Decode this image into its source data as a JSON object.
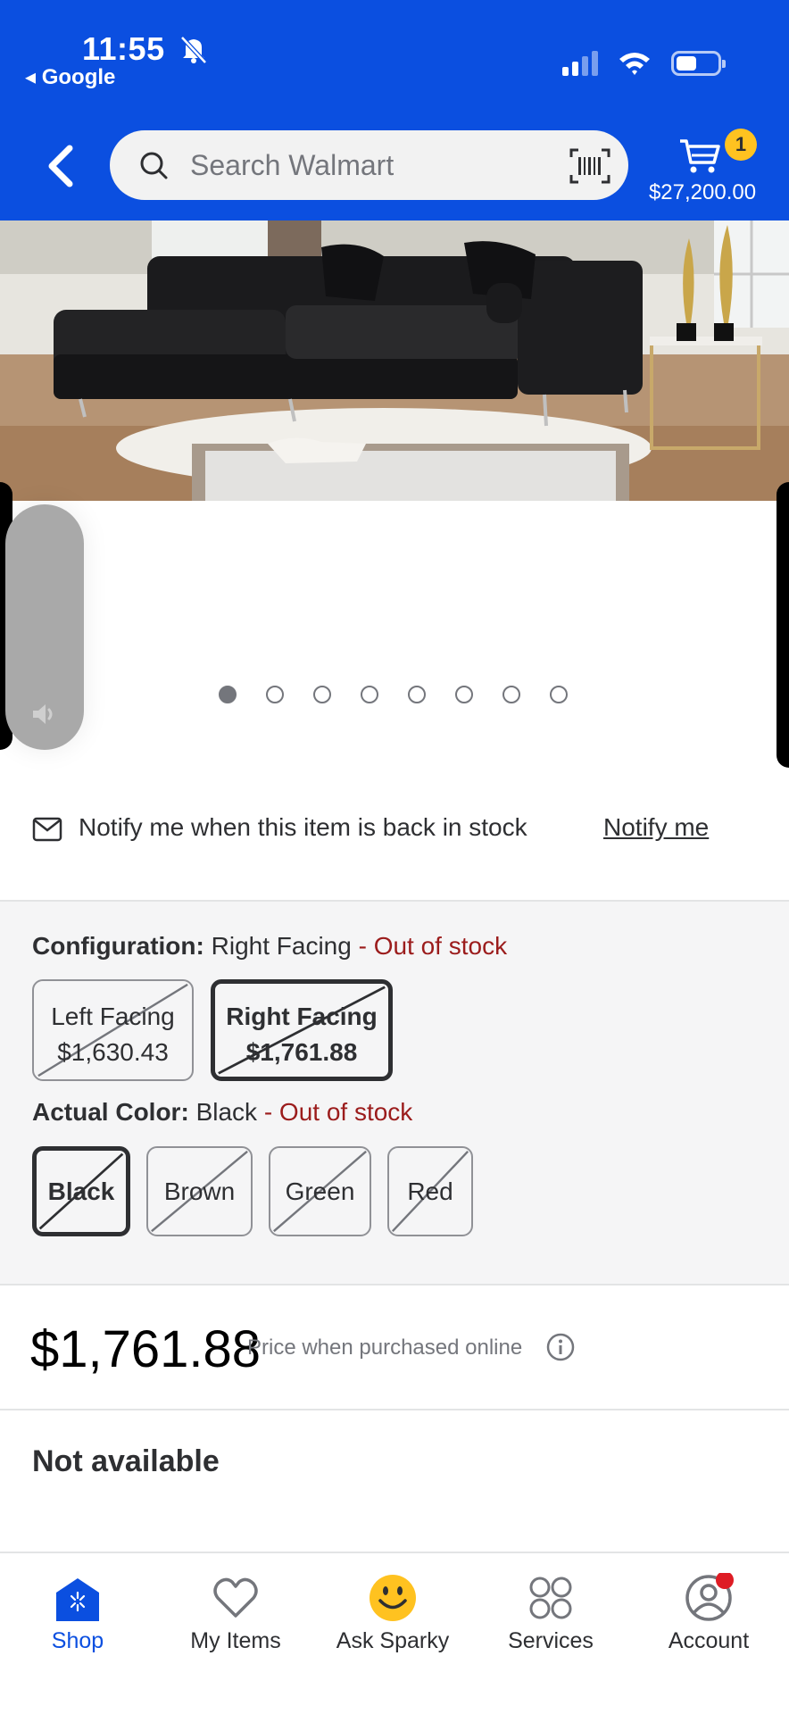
{
  "status_bar": {
    "time": "11:55",
    "back_app": "◂ Google",
    "icons": [
      "bell-off-icon",
      "signal-icon",
      "wifi-icon",
      "battery-icon"
    ]
  },
  "header": {
    "search_placeholder": "Search Walmart",
    "cart_count": "1",
    "cart_total": "$27,200.00",
    "brand_color": "#0b4fe0",
    "badge_color": "#ffc220"
  },
  "carousel": {
    "dot_count": 8,
    "active_index": 0
  },
  "notify": {
    "text": "Notify me when this item is back in stock",
    "link": "Notify me"
  },
  "configuration": {
    "label": "Configuration:",
    "value": "Right Facing",
    "status": "- Out of stock",
    "options": [
      {
        "name": "Left Facing",
        "price": "$1,630.43",
        "selected": false
      },
      {
        "name": "Right Facing",
        "price": "$1,761.88",
        "selected": true
      }
    ]
  },
  "color": {
    "label": "Actual Color:",
    "value": "Black",
    "status": "- Out of stock",
    "options": [
      {
        "name": "Black",
        "selected": true
      },
      {
        "name": "Brown",
        "selected": false
      },
      {
        "name": "Green",
        "selected": false
      },
      {
        "name": "Red",
        "selected": false
      }
    ]
  },
  "price": {
    "amount": "$1,761.88",
    "note": "Price when purchased online"
  },
  "availability": "Not available",
  "bottom_nav": {
    "items": [
      {
        "label": "Shop",
        "icon": "shop-icon",
        "active": true
      },
      {
        "label": "My Items",
        "icon": "heart-icon",
        "active": false
      },
      {
        "label": "Ask Sparky",
        "icon": "sparky-icon",
        "active": false
      },
      {
        "label": "Services",
        "icon": "services-icon",
        "active": false
      },
      {
        "label": "Account",
        "icon": "account-icon",
        "active": false
      }
    ]
  }
}
